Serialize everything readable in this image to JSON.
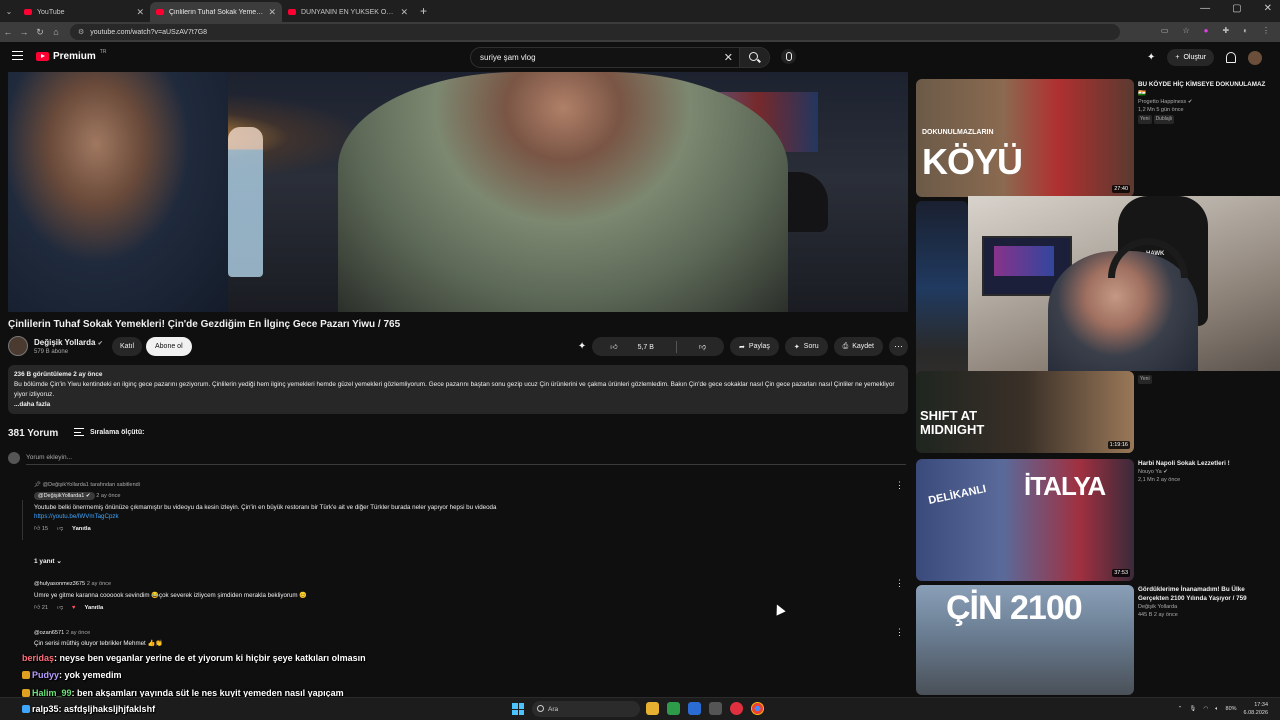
{
  "browser": {
    "tabs": [
      {
        "label": "YouTube",
        "active": false
      },
      {
        "label": "Çinlilerin Tuhaf Sokak Yemekleri",
        "active": true
      },
      {
        "label": "DÜNYANIN EN YÜKSEK OTELİ",
        "active": false
      }
    ],
    "url": "youtube.com/watch?v=aUSzAV7t7G8"
  },
  "masthead": {
    "brand": "Premium",
    "region": "TR",
    "search_value": "suriye şam vlog",
    "create_label": "Oluştur"
  },
  "video": {
    "title": "Çinlilerin Tuhaf Sokak Yemekleri! Çin'de Gezdiğim En İlginç Gece Pazarı Yiwu / 765",
    "channel": "Değişik Yollarda",
    "subscribers": "579 B abone",
    "join_label": "Katıl",
    "subscribe_label": "Abone ol",
    "likes": "5,7 B",
    "share_label": "Paylaş",
    "ask_label": "Soru",
    "save_label": "Kaydet",
    "description": {
      "meta": "236 B görüntüleme  2 ay önce",
      "text": "Bu bölümde Çin'in Yiwu kentindeki en ilginç gece pazarını geziyorum. Çinlilerin yediği hem ilginç yemekleri hemde güzel yemekleri gözlemliyorum. Gece pazarını baştan sonu gezip ucuz Çin ürünlerini ve çakma ürünleri gözlemledim. Bakın Çin'de gece sokaklar nasıl Çin gece pazarları nasıl Çinliler ne yemekliyor yiyor izliyoruz.",
      "more": "...daha fazla"
    }
  },
  "comments": {
    "count": "381 Yorum",
    "sort_label": "Sıralama ölçütü:",
    "add_placeholder": "Yorum ekleyin...",
    "items": [
      {
        "pinned_note": "@DeğişikYollarda1 tarafından sabitlendi",
        "handle": "@DeğişikYollarda1",
        "ago": "2 ay önce",
        "text": "Youtube belki önermemiş önünüze çıkmamıştır bu videoyu da kesin izleyin. Çin'in en büyük restoranı bir Türk'e ait ve diğer Türkler burada neler yapıyor hepsi bu videoda",
        "link": "https://youtu.be/lWVmTagCpzk",
        "likes": "15",
        "reply_label": "Yanıtla",
        "replies_label": "1 yanıt"
      },
      {
        "handle": "@hulyasonmez3675",
        "ago": "2 ay önce",
        "text": "Umre ye gitme karanna coooook sevindim 😂çok severek izliycem şimdiden merakla bekliyorum 😊",
        "likes": "21",
        "reply_label": "Yanıtla"
      },
      {
        "handle": "@ozan6571",
        "ago": "2 ay önce",
        "text": "Çin serisi müthiş oluyor tebrikler Mehmet 👍👏"
      }
    ]
  },
  "chat_overlay": [
    {
      "user": "beridaş",
      "message": ": neyse ben veganlar yerine de et yiyorum ki hiçbir şeye katkıları olmasın"
    },
    {
      "user": "Pudyy",
      "message": ": yok yemedim"
    },
    {
      "user": "Halim_99",
      "message": ": ben akşamları yayında süt le nes kuyit yemeden nasıl yapıçam"
    },
    {
      "user": "ralp35",
      "message": ": asfdşljhaksljhjfaklshf"
    }
  ],
  "recommendations": [
    {
      "thumb_text": "KÖYÜ",
      "thumb_small": "DOKUNULMAZLARIN",
      "duration": "27:40",
      "title": "BU KÖYDE HİÇ KİMSEYE DOKUNULAMAZ 🇮🇳",
      "channel": "Progetto Happiness",
      "meta": "1,2 Mn  5 gün önce",
      "tags": [
        "Yeni",
        "Dublajlı"
      ]
    },
    {
      "thumb_text": "SHIFT AT MIDNIGHT",
      "duration": "1:19:16",
      "title": "",
      "channel": "",
      "meta": "",
      "tags": [
        "Yeni"
      ]
    },
    {
      "thumb_text": "İTALYA",
      "thumb_small": "DELİKANLI",
      "duration": "37:53",
      "title": "Harbi Napoli Sokak Lezzetleri !",
      "channel": "Nouyo Ya",
      "meta": "2,1 Mn  2 ay önce",
      "tags": []
    },
    {
      "thumb_text": "ÇİN 2100",
      "duration": "",
      "title": "Gördüklerime İnanamadım! Bu Ülke Gerçekten 2100 Yılında Yaşıyor / 759",
      "channel": "Değişik Yollarda",
      "meta": "445 B  2 ay önce",
      "tags": []
    }
  ],
  "webcam": {
    "chair_brand": "HAWK"
  },
  "taskbar": {
    "search_label": "Ara",
    "time": "17:34",
    "date": "6.08.2026",
    "battery": "80%"
  }
}
